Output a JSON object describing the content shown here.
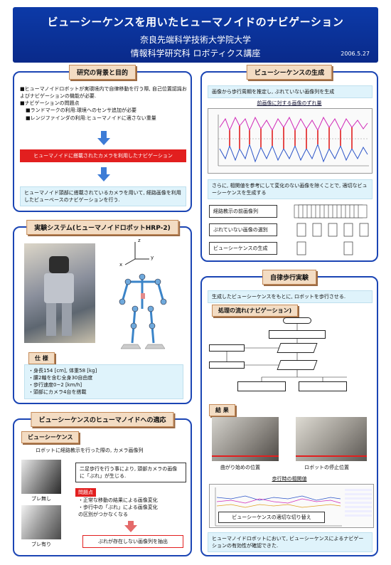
{
  "header": {
    "title": "ビューシーケンスを用いたヒューマノイドのナビゲーション",
    "affiliation1": "奈良先端科学技術大学院大学",
    "affiliation2": "情報科学研究科 ロボティクス講座",
    "date": "2006.5.27"
  },
  "bg": {
    "title": "研究の背景と目的",
    "p1": "■ヒューマノイドロボットが実環境内で自律移動を行う際, 自己位置認識およびナビゲーションの機能が必要.",
    "p2": "■ナビゲーションの問題点",
    "p3": "■ランドマークの利用:環境へのセンサ追加が必要",
    "p4": "■レンジファインダの利用:ヒューマノイドに適さない重量",
    "red": "ヒューマノイドに搭載されたカメラを利用したナビゲーション",
    "goal": "ヒューマノイド頭部に搭載されているカメラを用いて, 経路画像を利用したビューベースのナビゲーションを行う."
  },
  "exp": {
    "title": "実験システム(ヒューマノイドロボットHRP-2)",
    "axis_z": "z",
    "axis_x": "x",
    "axis_y": "y",
    "spec_label": "仕 様",
    "specs": [
      "・身長154 [cm], 体重58 [kg]",
      "・腰2軸を含む全身30自由度",
      "・歩行速度0~2 [km/h]",
      "・頭部にカメラ4台を搭載"
    ]
  },
  "apply": {
    "title": "ビューシーケンスのヒューマノイドへの適応",
    "sub": "ビューシーケンス",
    "caption": "ロボットに経路教示を行った際の, カメラ画像列",
    "note": "二足歩行を行う事により, 頭部カメラの画像に「ぶれ」が生じる.",
    "issue": "問題点",
    "i1": "・正常な移動の結果による画像変化",
    "i2": "・歩行中の「ぶれ」による画像変化",
    "i3": "の区別がつかなくなる",
    "lbl_noblur": "ブレ無し",
    "lbl_blur": "ブレ有り",
    "extract": "ぶれが存在しない画像列を抽出"
  },
  "gen": {
    "title": "ビューシーケンスの生成",
    "intro": "画像から歩行周期を推定し, ぶれていない画像列を生成",
    "graph_title": "前画像に対する画像のずれ量",
    "desc": "さらに, 相関値を参考にして変化のない画像を除くことで, 適切なビューシーケンスを生成する",
    "steps": [
      "経路教示の前画像列",
      "ぶれていない画像の選別",
      "ビューシーケンスの生成"
    ]
  },
  "walk": {
    "title": "自律歩行実験",
    "intro": "生成したビューシーケンスをもとに, ロボットを歩行させる.",
    "flow_label": "処理の流れ(ナビゲーション)",
    "result_label": "結 果",
    "cap1": "曲がり始めの位置",
    "cap2": "ロボットの停止位置",
    "graph_title": "歩行時の相関値",
    "switch": "ビューシーケンスの適切な切り替え",
    "conclusion": "ヒューマノイドロボットにおいて, ビューシーケンスによるナビゲーションの有効性が確認できた."
  },
  "colors": {
    "navy": "#0a2a8a",
    "panel_border": "#1b45b4",
    "label_bg": "#f3dcc3",
    "red": "#e21f1f",
    "light_blue": "#dff3fb"
  }
}
